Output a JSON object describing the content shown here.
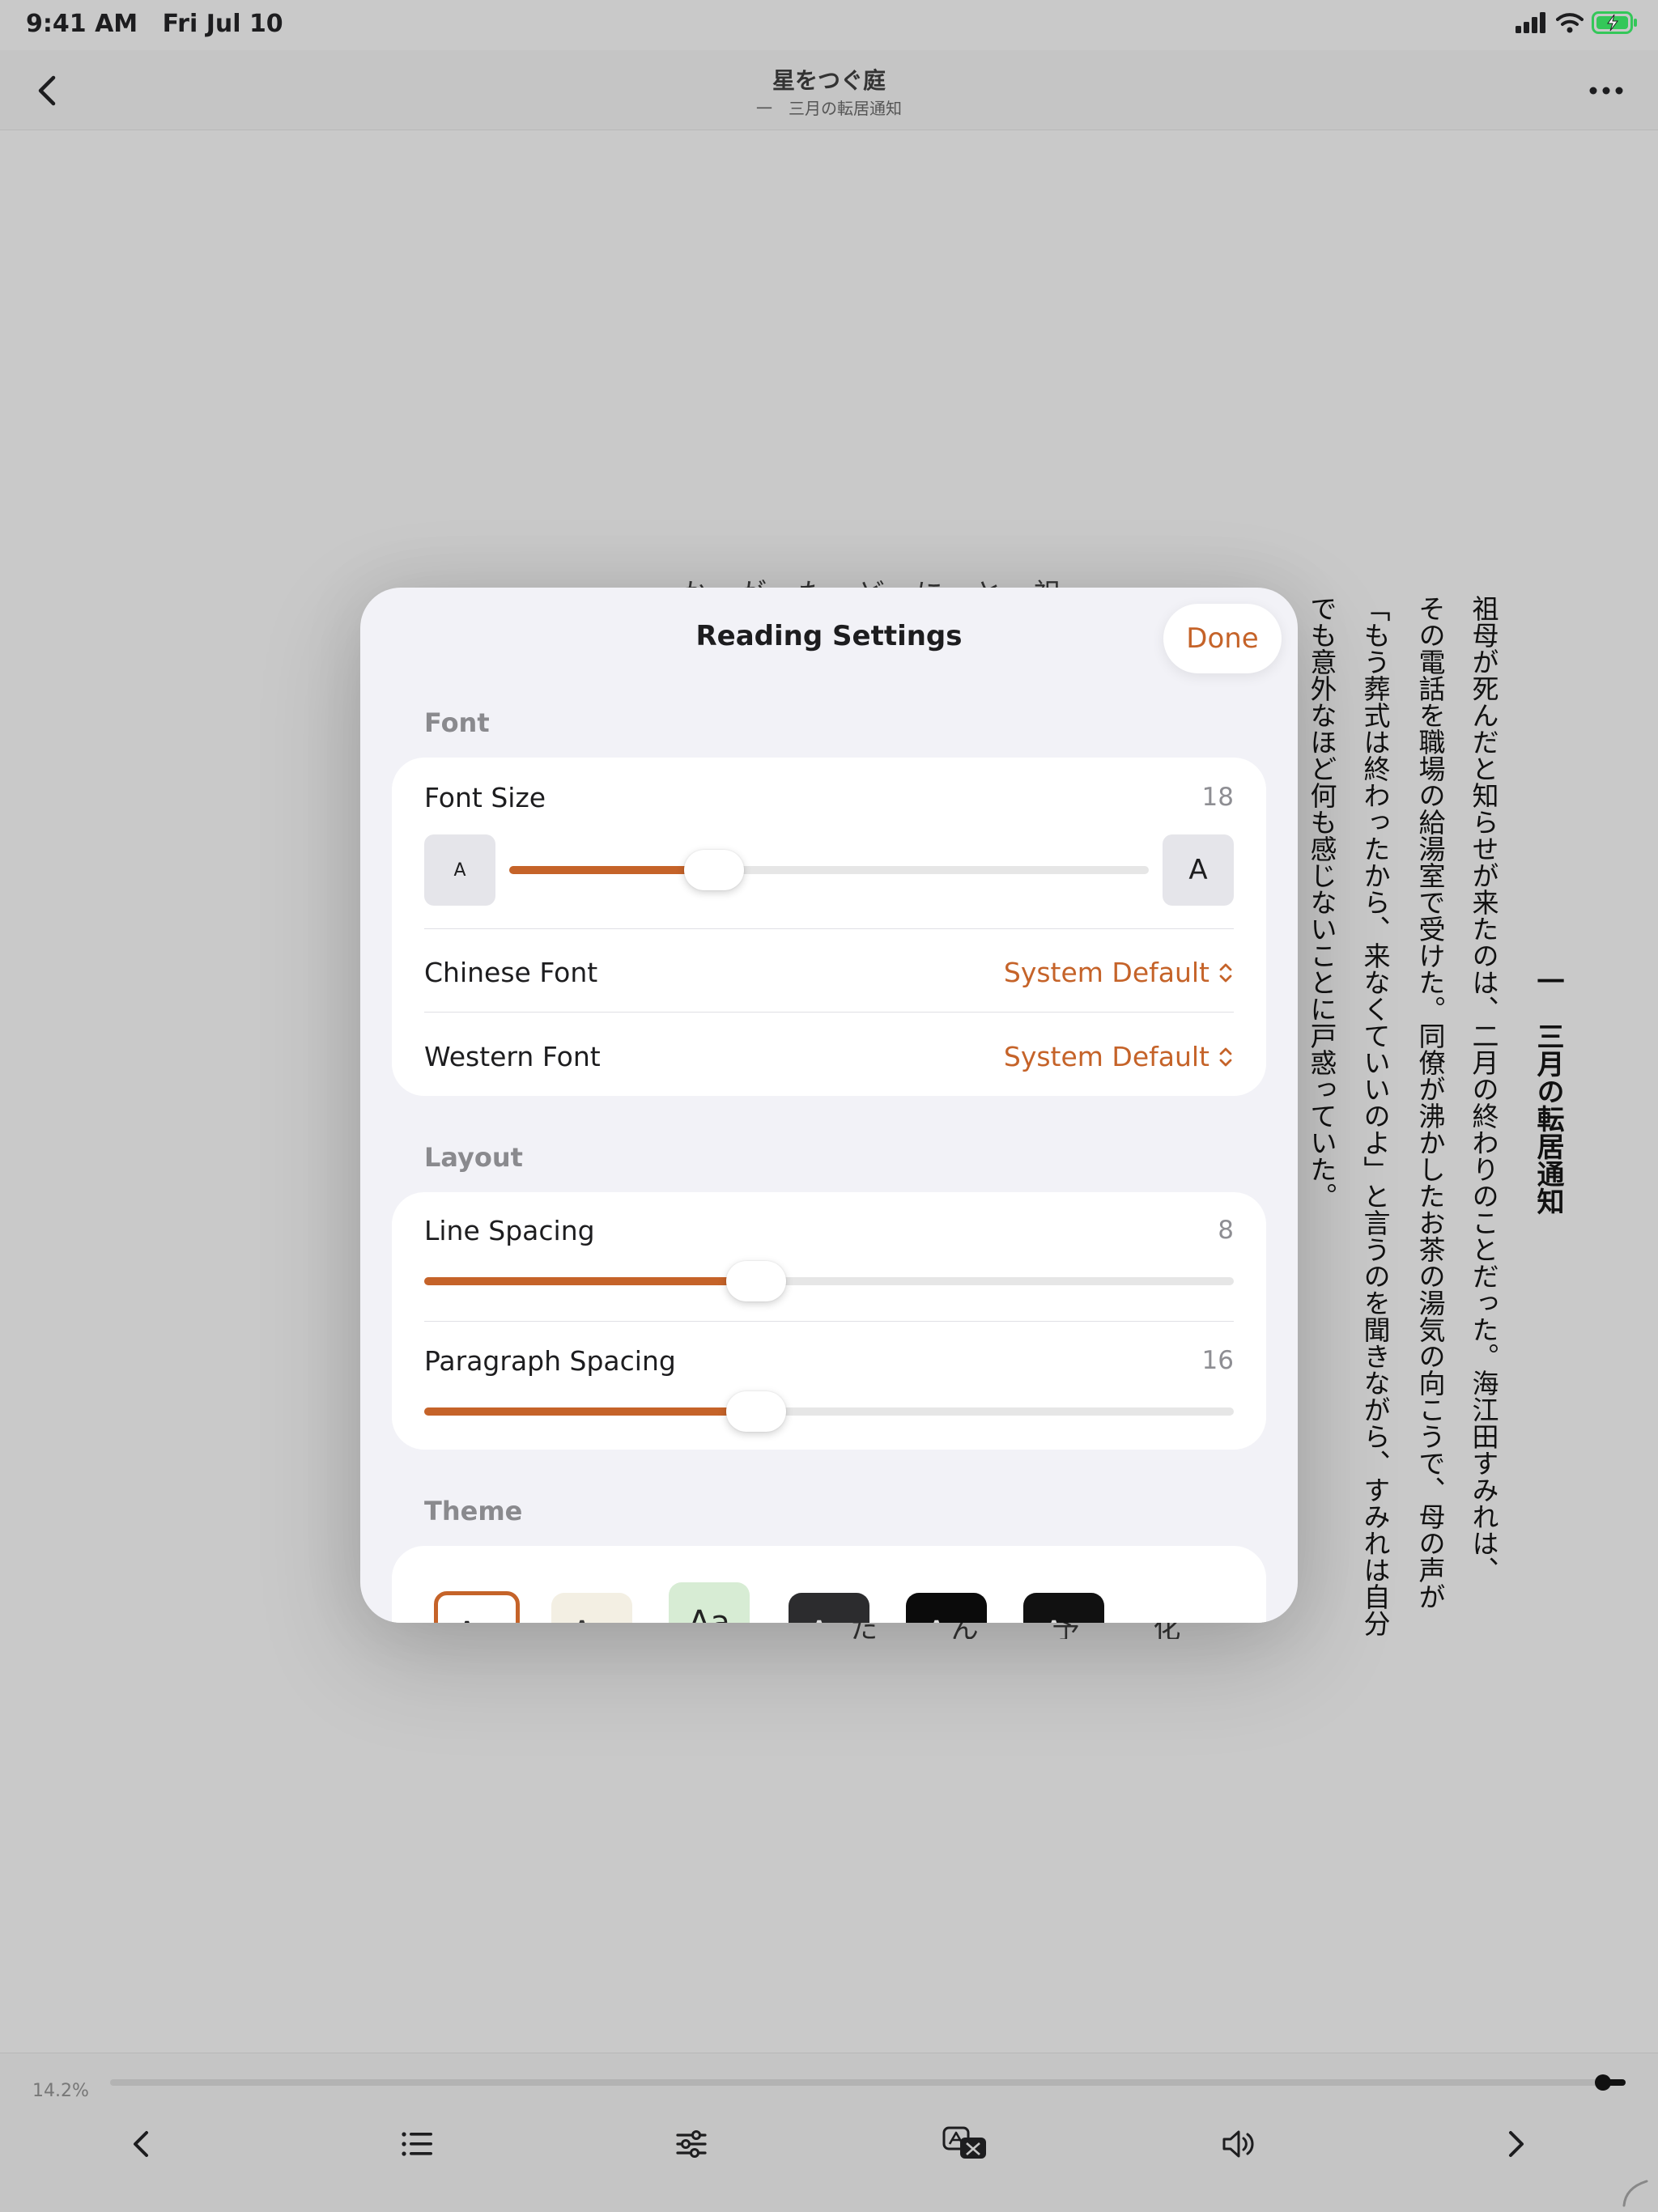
{
  "status_bar": {
    "time": "9:41 AM",
    "date": "Fri Jul 10"
  },
  "nav": {
    "title": "星をつぐ庭",
    "subtitle": "一　三月の転居通知"
  },
  "book": {
    "chapter_title": "一　三月の転居通知",
    "paragraph_lines": [
      "祖母が死んだと知らせが来たのは、二月の終わりのことだった。海江田すみれは、",
      "その電話を職場の給湯室で受けた。同僚が沸かしたお茶の湯気の向こうで、母の声が",
      "「もう葬式は終わったから、来なくていいのよ」と言うのを聞きながら、すみれは自分",
      "でも意外なほど何も感じないことに戸惑っていた。"
    ],
    "hidden_top": "か が た ど に と 祖",
    "hidden_bottom": "た ん 予 化"
  },
  "sheet": {
    "title": "Reading Settings",
    "done_label": "Done",
    "font_section": {
      "label": "Font",
      "font_size": {
        "label": "Font Size",
        "value": "18",
        "level": 0.32,
        "small_a": "A",
        "large_a": "A"
      },
      "chinese_font": {
        "label": "Chinese Font",
        "value": "System Default"
      },
      "western_font": {
        "label": "Western Font",
        "value": "System Default"
      }
    },
    "layout_section": {
      "label": "Layout",
      "line_spacing": {
        "label": "Line Spacing",
        "value": "8",
        "level": 0.41
      },
      "paragraph_spacing": {
        "label": "Paragraph Spacing",
        "value": "16",
        "level": 0.41
      }
    },
    "theme_section": {
      "label": "Theme",
      "swatch_glyph": "Aa",
      "selected_index": 0
    }
  },
  "bottom_bar": {
    "progress_text": "14.2%",
    "progress_knob": 0.985
  },
  "colors": {
    "accent": "#c56329",
    "sheet_bg": "#f2f2f7",
    "backdrop": "#c9c9c9"
  }
}
